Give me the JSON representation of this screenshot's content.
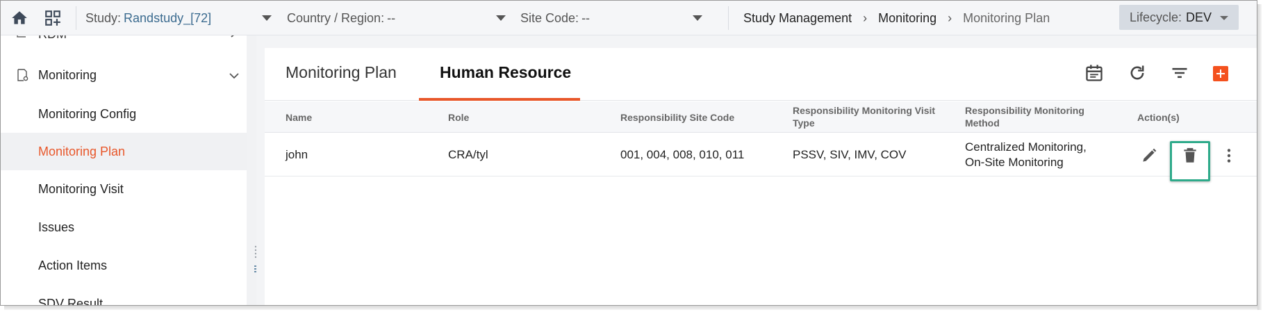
{
  "topbar": {
    "study_label": "Study:",
    "study_value": "Randstudy_[72]",
    "country_label": "Country / Region:",
    "country_value": "--",
    "site_label": "Site Code:",
    "site_value": "--",
    "breadcrumbs": [
      "Study Management",
      "Monitoring",
      "Monitoring Plan"
    ],
    "lifecycle_label": "Lifecycle:",
    "lifecycle_value": "DEV"
  },
  "sidebar": {
    "partial_top_item": "RDM",
    "parent": "Monitoring",
    "items": [
      {
        "label": "Monitoring Config"
      },
      {
        "label": "Monitoring Plan"
      },
      {
        "label": "Monitoring Visit"
      },
      {
        "label": "Issues"
      },
      {
        "label": "Action Items"
      },
      {
        "label": "SDV Result"
      }
    ],
    "active_item": "Monitoring Plan"
  },
  "tabs": [
    {
      "label": "Monitoring Plan"
    },
    {
      "label": "Human Resource"
    }
  ],
  "active_tab": "Human Resource",
  "table": {
    "headers": {
      "name": "Name",
      "role": "Role",
      "site_code": "Responsibility Site Code",
      "visit_type_1": "Responsibility Monitoring Visit",
      "visit_type_2": "Type",
      "method_1": "Responsibility Monitoring",
      "method_2": "Method",
      "actions": "Action(s)"
    },
    "rows": [
      {
        "name": "john",
        "role": "CRA/tyl",
        "site_code": "001, 004, 008, 010, 011",
        "visit_type": "PSSV, SIV, IMV, COV",
        "method_1": "Centralized Monitoring,",
        "method_2": "On-Site Monitoring"
      }
    ]
  },
  "colors": {
    "accent": "#e8572a",
    "add_button": "#f4511e",
    "highlight": "#2eaa8a"
  },
  "icons": [
    "home-icon",
    "apps-add-icon",
    "calendar-icon",
    "refresh-icon",
    "filter-icon",
    "add-icon",
    "pencil-icon",
    "trash-icon",
    "more-vert-icon"
  ]
}
